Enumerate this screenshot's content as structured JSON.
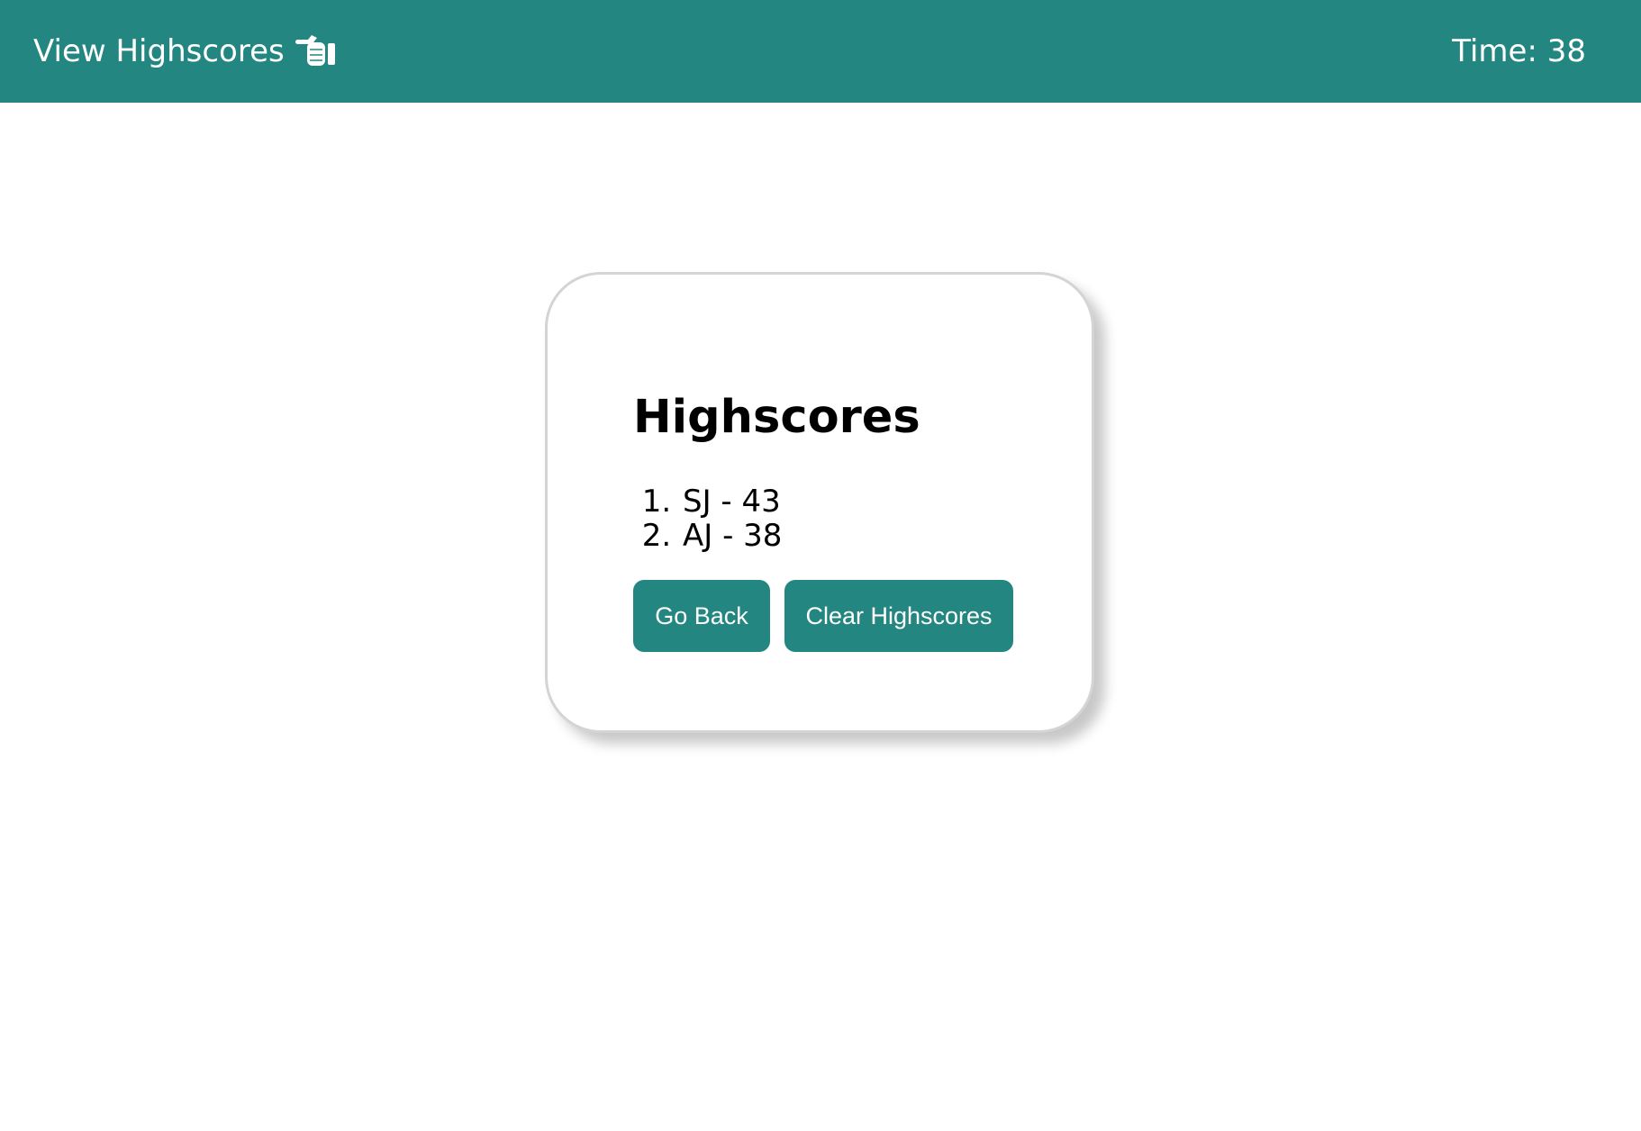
{
  "header": {
    "view_highscores_label": "View Highscores",
    "hand_icon": "pointing-hand-icon",
    "timer_text": "Time: 38",
    "background_color": "#238681"
  },
  "card": {
    "title": "Highscores",
    "scores": [
      {
        "text": "SJ - 43"
      },
      {
        "text": "AJ - 38"
      }
    ],
    "go_back_label": "Go Back",
    "clear_label": "Clear Highscores",
    "button_color": "#238681"
  }
}
